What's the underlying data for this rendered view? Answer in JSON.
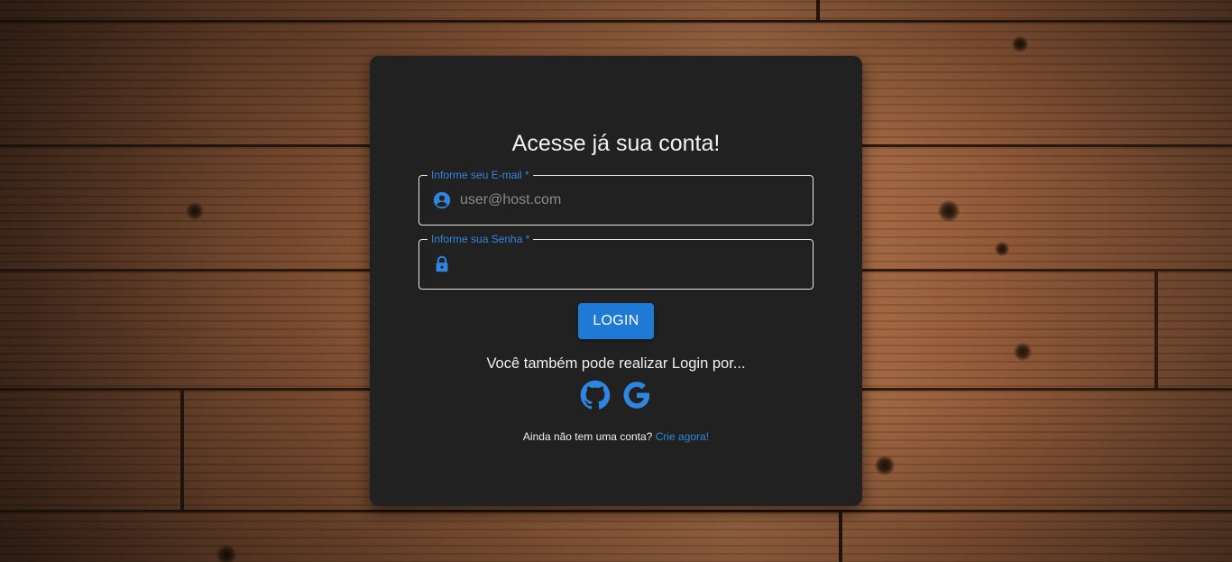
{
  "login": {
    "title": "Acesse já sua conta!",
    "email_label": "Informe seu E-mail *",
    "email_placeholder": "user@host.com",
    "email_value": "",
    "password_label": "Informe sua Senha *",
    "password_value": "",
    "login_button": "LOGIN",
    "alt_login_text": "Você também pode realizar Login por...",
    "social_icons": [
      "github-icon",
      "google-icon"
    ],
    "signup_prompt": "Ainda não tem uma conta?",
    "signup_link": "Crie agora!"
  },
  "colors": {
    "card_background": "#212121",
    "accent": "#1f7ad6",
    "label": "#2f86e0"
  },
  "icons": {
    "email": "account-circle-icon",
    "password": "lock-icon"
  }
}
